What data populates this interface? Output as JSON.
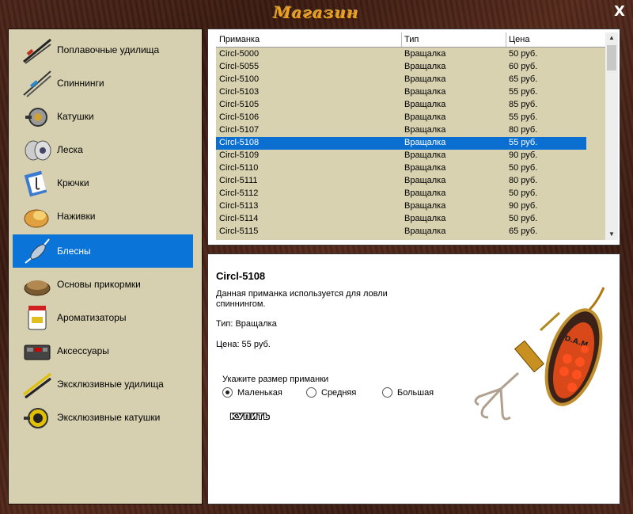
{
  "window": {
    "title": "Магазин",
    "close_label": "X"
  },
  "categories": [
    {
      "label": "Поплавочные удилища",
      "icon": "float-rod-icon"
    },
    {
      "label": "Спиннинги",
      "icon": "spinning-rod-icon"
    },
    {
      "label": "Катушки",
      "icon": "reel-icon"
    },
    {
      "label": "Леска",
      "icon": "fishing-line-icon"
    },
    {
      "label": "Крючки",
      "icon": "hooks-icon"
    },
    {
      "label": "Наживки",
      "icon": "bait-icon"
    },
    {
      "label": "Блесны",
      "icon": "spoon-lure-icon"
    },
    {
      "label": "Основы прикормки",
      "icon": "groundbait-icon"
    },
    {
      "label": "Ароматизаторы",
      "icon": "flavoring-icon"
    },
    {
      "label": "Аксессуары",
      "icon": "accessories-icon"
    },
    {
      "label": "Эксклюзивные удилища",
      "icon": "exclusive-rods-icon"
    },
    {
      "label": "Эксклюзивные катушки",
      "icon": "exclusive-reels-icon"
    }
  ],
  "active_category": "Блесны",
  "list": {
    "headers": [
      "Приманка",
      "Тип",
      "Цена"
    ],
    "rows": [
      [
        "Circl-5000",
        "Вращалка",
        "50 руб."
      ],
      [
        "Circl-5055",
        "Вращалка",
        "60 руб."
      ],
      [
        "Circl-5100",
        "Вращалка",
        "65 руб."
      ],
      [
        "Circl-5103",
        "Вращалка",
        "55 руб."
      ],
      [
        "Circl-5105",
        "Вращалка",
        "85 руб."
      ],
      [
        "Circl-5106",
        "Вращалка",
        "55 руб."
      ],
      [
        "Circl-5107",
        "Вращалка",
        "80 руб."
      ],
      [
        "Circl-5108",
        "Вращалка",
        "55 руб."
      ],
      [
        "Circl-5109",
        "Вращалка",
        "90 руб."
      ],
      [
        "Circl-5110",
        "Вращалка",
        "50 руб."
      ],
      [
        "Circl-5111",
        "Вращалка",
        "80 руб."
      ],
      [
        "Circl-5112",
        "Вращалка",
        "50 руб."
      ],
      [
        "Circl-5113",
        "Вращалка",
        "90 руб."
      ],
      [
        "Circl-5114",
        "Вращалка",
        "50 руб."
      ],
      [
        "Circl-5115",
        "Вращалка",
        "65 руб."
      ]
    ],
    "selected_row": "Circl-5108"
  },
  "detail": {
    "name": "Circl-5108",
    "description": "Данная приманка используется для ловли спиннингом.",
    "type_line": "Тип: Вращалка",
    "price_line": "Цена: 55 руб.",
    "size_prompt": "Укажите размер приманки",
    "sizes": [
      "Маленькая",
      "Средняя",
      "Большая"
    ],
    "selected_size": "Маленькая",
    "buy_label": "КУПИТЬ",
    "lure_brand": "D.A.M"
  },
  "colors": {
    "title": "#f0a020",
    "selection": "#0a74d8",
    "panel_bg": "#d6d0b0",
    "lure_body": "#d84818",
    "lure_dots": "#ff5020"
  }
}
